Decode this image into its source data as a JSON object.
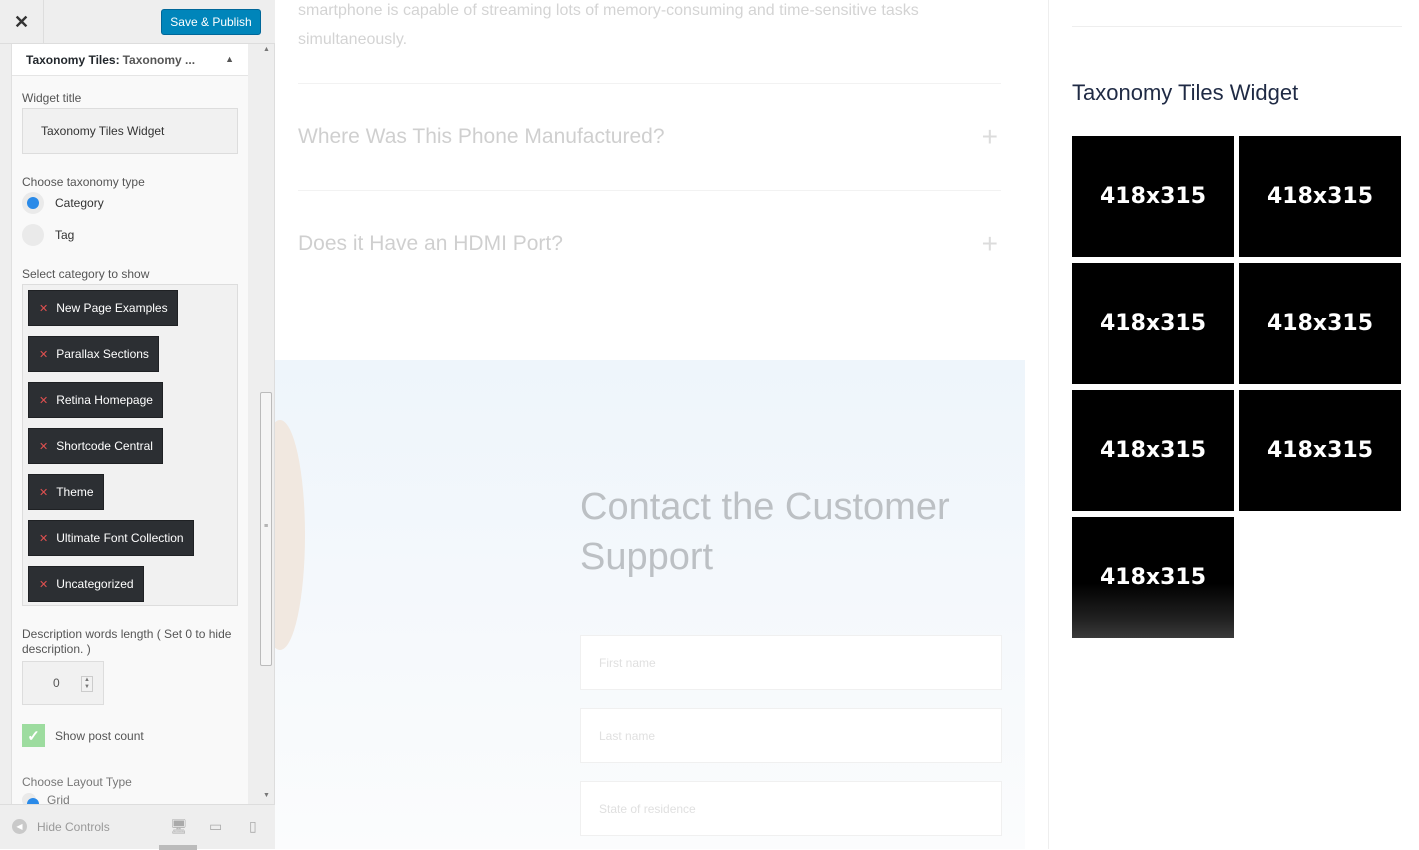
{
  "header": {
    "publish_label": "Save & Publish"
  },
  "widget": {
    "title_bold": "Taxonomy Tiles:",
    "title_sub": "Taxonomy ...",
    "widget_title_label": "Widget title",
    "widget_title_value": "Taxonomy Tiles Widget",
    "taxonomy_type_label": "Choose taxonomy type",
    "taxonomy_options": [
      "Category",
      "Tag"
    ],
    "select_category_label": "Select category to show",
    "categories": [
      "New Page Examples",
      "Parallax Sections",
      "Retina Homepage",
      "Shortcode Central",
      "Theme",
      "Ultimate Font Collection",
      "Uncategorized"
    ],
    "desc_length_label": "Description words length ( Set 0 to hide description. )",
    "desc_length_value": "0",
    "show_post_count_label": "Show post count",
    "layout_type_label": "Choose Layout Type",
    "layout_option_partial": "Grid"
  },
  "footer": {
    "hide_controls_label": "Hide Controls"
  },
  "preview": {
    "intro_text": "smartphone is capable of streaming lots of memory-consuming and time-sensitive tasks simultaneously.",
    "faq": [
      "Where Was This Phone Manufactured?",
      "Does it Have an HDMI Port?"
    ],
    "contact_title": "Contact the Customer Support",
    "form_placeholders": [
      "First name",
      "Last name",
      "State of residence"
    ],
    "sidebar_widget_title": "Taxonomy Tiles Widget",
    "tile_label": "418x315"
  },
  "colors": {
    "accent": "#0085ba",
    "chip_bg": "#2c2f33",
    "radio_on": "#2a8ae8",
    "check": "#9ddc9f"
  }
}
